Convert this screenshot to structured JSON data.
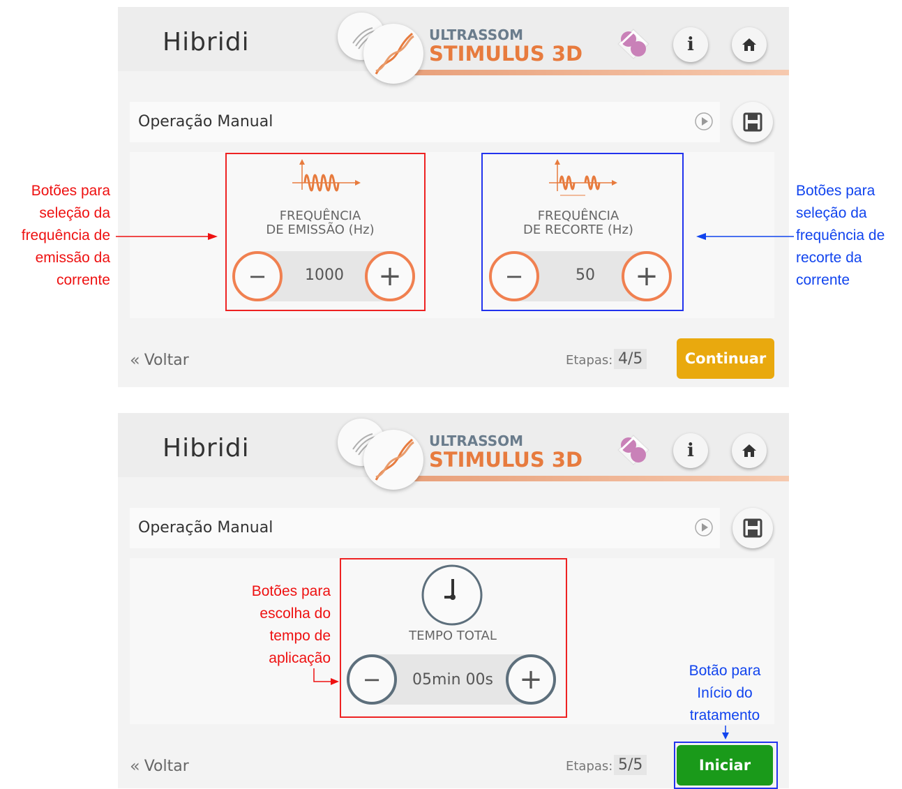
{
  "screen1": {
    "logo": "Hibridi",
    "title_top": "ULTRASSOM",
    "title_main": "STIMULUS 3D",
    "operation_title": "Operação Manual",
    "control_a": {
      "label_line1": "FREQUÊNCIA",
      "label_line2": "DE EMISSÃO (Hz)",
      "minus": "−",
      "value": "1000",
      "plus": "+"
    },
    "control_b": {
      "label_line1": "FREQUÊNCIA",
      "label_line2": "DE RECORTE (Hz)",
      "minus": "−",
      "value": "50",
      "plus": "+"
    },
    "back_label": "Voltar",
    "steps_label": "Etapas:",
    "steps_value": "4/5",
    "continue_label": "Continuar"
  },
  "screen2": {
    "logo": "Hibridi",
    "title_top": "ULTRASSOM",
    "title_main": "STIMULUS 3D",
    "operation_title": "Operação Manual",
    "timer": {
      "label": "TEMPO TOTAL",
      "minus": "−",
      "value": "05min 00s",
      "plus": "+"
    },
    "back_label": "Voltar",
    "steps_label": "Etapas:",
    "steps_value": "5/5",
    "start_label": "Iniciar"
  },
  "annotations": {
    "left_red": [
      "Botões para",
      "seleção da",
      "frequência de",
      "emissão da",
      "corrente"
    ],
    "right_blue": [
      "Botões para",
      "seleção da",
      "frequência de",
      "recorte da",
      "corrente"
    ],
    "timer_red": [
      "Botões para",
      "escolha do",
      "tempo de",
      "aplicação"
    ],
    "start_blue": [
      "Botão para",
      "Início do",
      "tratamento"
    ]
  },
  "colors": {
    "accent_orange": "#e77b3e",
    "continue_yellow": "#e9a90e",
    "start_green": "#1a9a1a",
    "annotation_red": "#ee1111",
    "annotation_blue": "#1144ee"
  },
  "icons": [
    "ultrasound-wave-icon",
    "stimulus-helix-icon",
    "bluetooth-link-icon",
    "info-icon",
    "home-icon",
    "play-icon",
    "save-icon",
    "sine-wave-icon",
    "burst-wave-icon",
    "clock-icon",
    "chevron-double-left-icon"
  ]
}
